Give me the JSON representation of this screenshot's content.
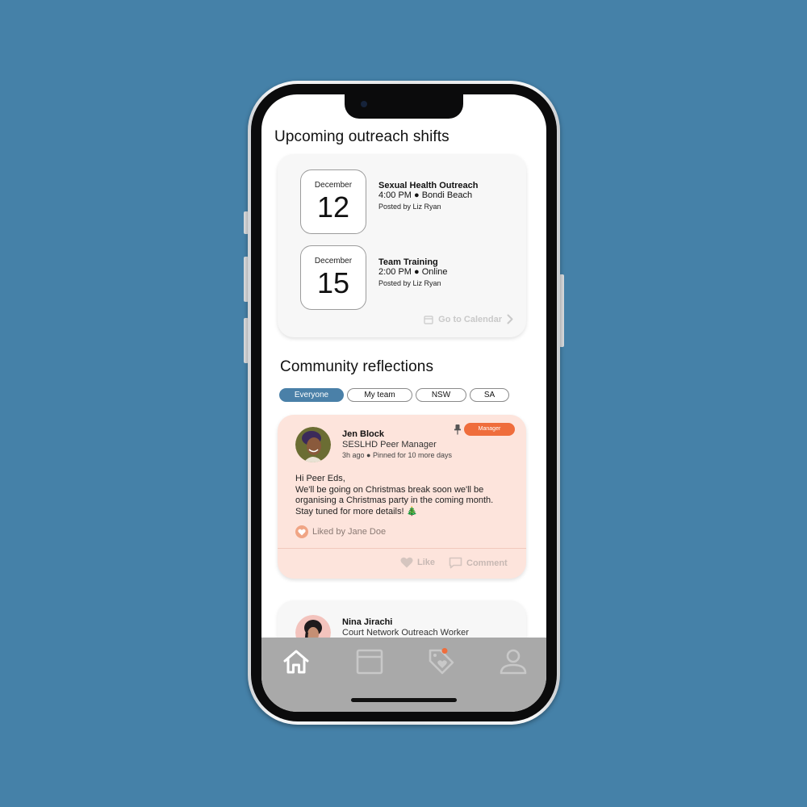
{
  "upcoming": {
    "heading": "Upcoming outreach shifts",
    "shifts": [
      {
        "month": "December",
        "day": "12",
        "title": "Sexual Health Outreach",
        "meta": "4:00 PM ● Bondi Beach",
        "posted": "Posted by Liz Ryan"
      },
      {
        "month": "December",
        "day": "15",
        "title": "Team Training",
        "meta": "2:00 PM ● Online",
        "posted": "Posted by Liz Ryan"
      }
    ],
    "calendar_link": "Go to Calendar"
  },
  "community": {
    "heading": "Community reflections",
    "filters": [
      {
        "label": "Everyone",
        "active": true
      },
      {
        "label": "My team",
        "active": false
      },
      {
        "label": "NSW",
        "active": false
      },
      {
        "label": "SA",
        "active": false
      }
    ],
    "posts": [
      {
        "author": "Jen Block",
        "role": "SESLHD Peer Manager",
        "time": "3h ago ● Pinned for 10 more days",
        "badge": "Manager",
        "body_lines": [
          "Hi Peer Eds,",
          "We'll be going on Christmas break soon we'll be organising a Christmas party in the coming month. Stay tuned for more details! 🎄"
        ],
        "liked_by": "Liked by Jane Doe",
        "like_label": "Like",
        "comment_label": "Comment"
      },
      {
        "author": "Nina Jirachi",
        "role": "Court Network Outreach Worker"
      }
    ]
  },
  "tabbar": {
    "tabs": [
      {
        "icon": "home-icon"
      },
      {
        "icon": "calendar-icon"
      },
      {
        "icon": "tag-heart-icon"
      },
      {
        "icon": "profile-icon"
      }
    ]
  },
  "colors": {
    "background": "#4581a8",
    "accent": "#4a80a8",
    "badge": "#ef6d3c",
    "post_highlight": "#fde4dc",
    "tabbar": "#a9a9a9"
  }
}
